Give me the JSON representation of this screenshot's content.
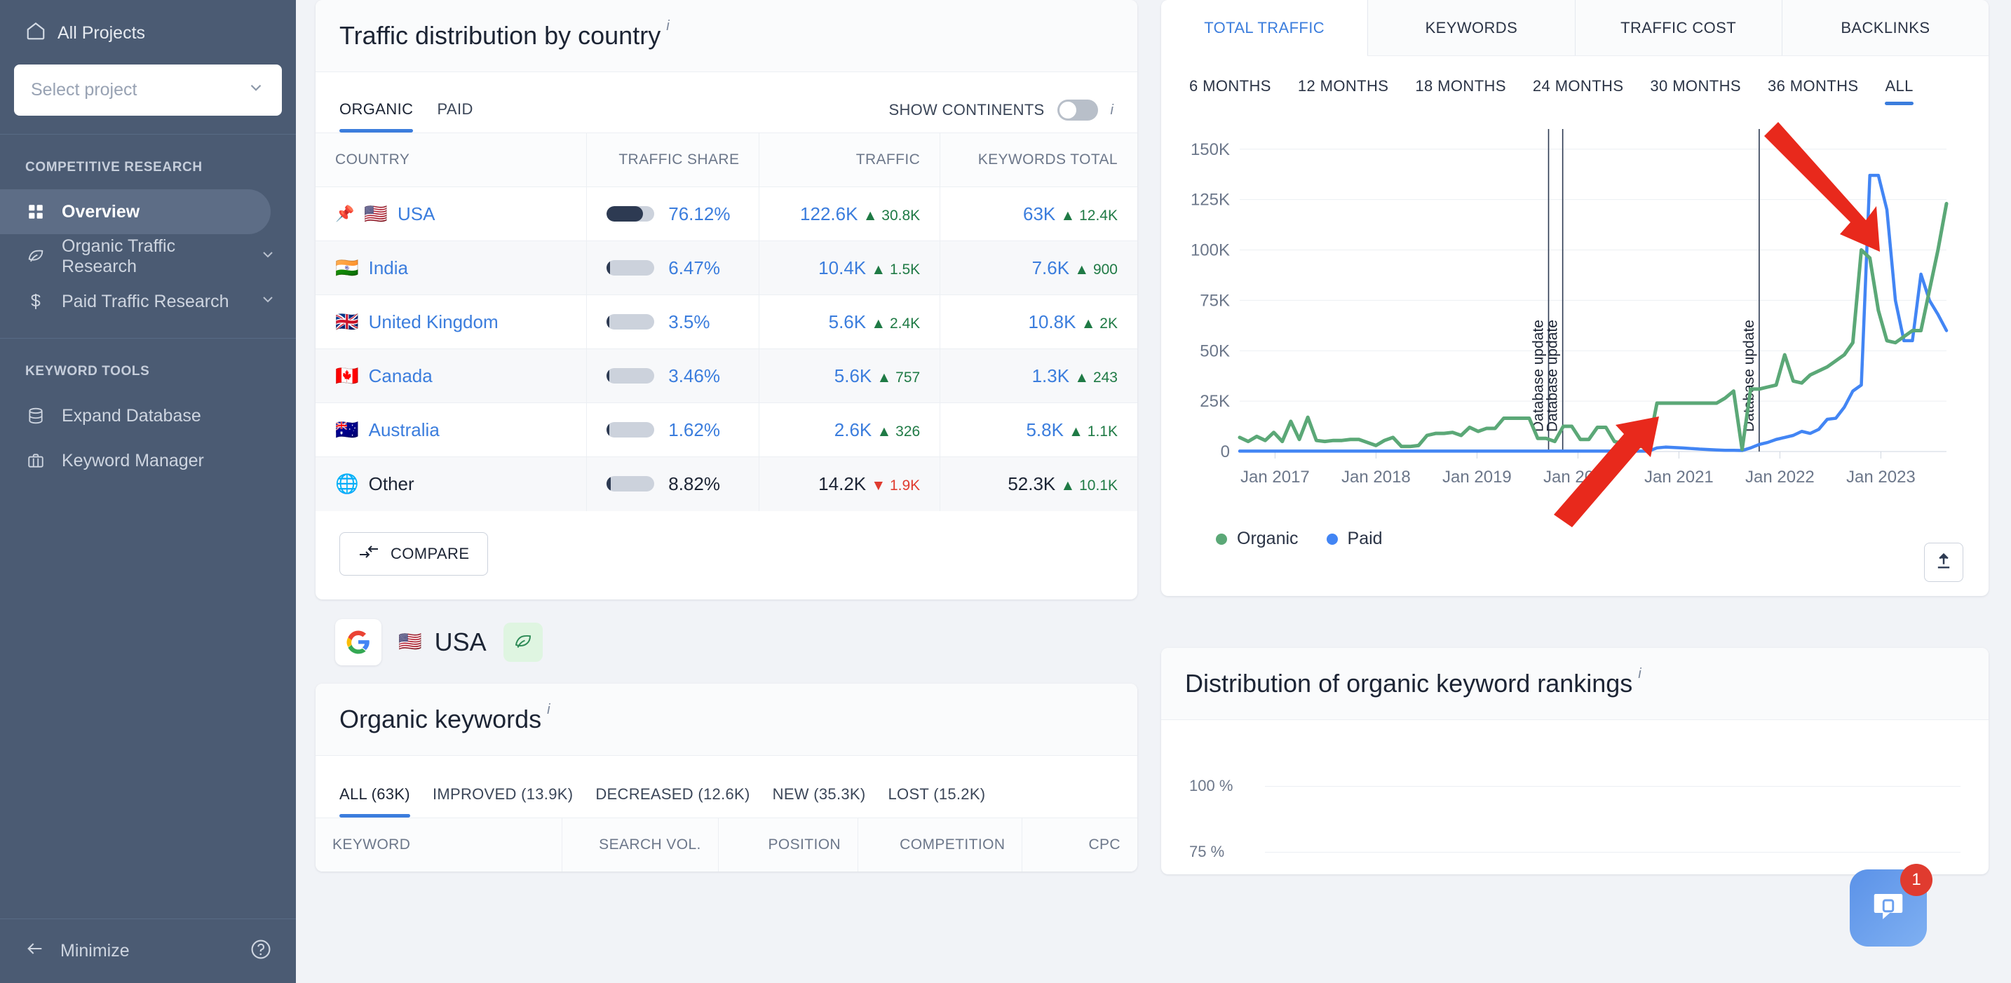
{
  "sidebar": {
    "all_projects": "All Projects",
    "project_select_placeholder": "Select project",
    "sections": [
      {
        "label": "COMPETITIVE RESEARCH",
        "items": [
          {
            "label": "Overview",
            "icon": "grid-icon",
            "active": true,
            "chevron": false
          },
          {
            "label": "Organic Traffic Research",
            "icon": "leaf-icon",
            "active": false,
            "chevron": true
          },
          {
            "label": "Paid Traffic Research",
            "icon": "dollar-icon",
            "active": false,
            "chevron": true
          }
        ]
      },
      {
        "label": "KEYWORD TOOLS",
        "items": [
          {
            "label": "Expand Database",
            "icon": "database-icon",
            "active": false,
            "chevron": false
          },
          {
            "label": "Keyword Manager",
            "icon": "briefcase-icon",
            "active": false,
            "chevron": false
          }
        ]
      }
    ],
    "minimize": "Minimize",
    "help_icon": "help-circle-icon"
  },
  "traffic_card": {
    "title": "Traffic distribution by country",
    "info_icon": "i",
    "tabs": [
      {
        "label": "ORGANIC",
        "active": true
      },
      {
        "label": "PAID",
        "active": false
      }
    ],
    "toggle_label": "SHOW CONTINENTS",
    "toggle_on": false,
    "columns": [
      "COUNTRY",
      "TRAFFIC SHARE",
      "TRAFFIC",
      "KEYWORDS TOTAL"
    ],
    "rows": [
      {
        "flag": "🇺🇸",
        "pinned": true,
        "country": "USA",
        "share_pct": 76.12,
        "share": "76.12%",
        "traffic": "122.6K",
        "traffic_delta": "30.8K",
        "traffic_dir": "up",
        "keywords": "63K",
        "keywords_delta": "12.4K",
        "keywords_dir": "up",
        "other": false
      },
      {
        "flag": "🇮🇳",
        "pinned": false,
        "country": "India",
        "share_pct": 6.47,
        "share": "6.47%",
        "traffic": "10.4K",
        "traffic_delta": "1.5K",
        "traffic_dir": "up",
        "keywords": "7.6K",
        "keywords_delta": "900",
        "keywords_dir": "up",
        "other": false
      },
      {
        "flag": "🇬🇧",
        "pinned": false,
        "country": "United Kingdom",
        "share_pct": 3.5,
        "share": "3.5%",
        "traffic": "5.6K",
        "traffic_delta": "2.4K",
        "traffic_dir": "up",
        "keywords": "10.8K",
        "keywords_delta": "2K",
        "keywords_dir": "up",
        "other": false
      },
      {
        "flag": "🇨🇦",
        "pinned": false,
        "country": "Canada",
        "share_pct": 3.46,
        "share": "3.46%",
        "traffic": "5.6K",
        "traffic_delta": "757",
        "traffic_dir": "up",
        "keywords": "1.3K",
        "keywords_delta": "243",
        "keywords_dir": "up",
        "other": false
      },
      {
        "flag": "🇦🇺",
        "pinned": false,
        "country": "Australia",
        "share_pct": 1.62,
        "share": "1.62%",
        "traffic": "2.6K",
        "traffic_delta": "326",
        "traffic_dir": "up",
        "keywords": "5.8K",
        "keywords_delta": "1.1K",
        "keywords_dir": "up",
        "other": false
      },
      {
        "flag": "🌐",
        "pinned": false,
        "country": "Other",
        "share_pct": 8.82,
        "share": "8.82%",
        "traffic": "14.2K",
        "traffic_delta": "1.9K",
        "traffic_dir": "down",
        "keywords": "52.3K",
        "keywords_delta": "10.1K",
        "keywords_dir": "up",
        "other": true
      }
    ],
    "compare_button": "COMPARE",
    "compare_icon": "compare-arrows-icon"
  },
  "chart_card": {
    "tabs": [
      {
        "label": "TOTAL TRAFFIC",
        "active": true
      },
      {
        "label": "KEYWORDS",
        "active": false
      },
      {
        "label": "TRAFFIC COST",
        "active": false
      },
      {
        "label": "BACKLINKS",
        "active": false
      }
    ],
    "ranges": [
      {
        "label": "6 MONTHS",
        "active": false
      },
      {
        "label": "12 MONTHS",
        "active": false
      },
      {
        "label": "18 MONTHS",
        "active": false
      },
      {
        "label": "24 MONTHS",
        "active": false
      },
      {
        "label": "30 MONTHS",
        "active": false
      },
      {
        "label": "36 MONTHS",
        "active": false
      },
      {
        "label": "ALL",
        "active": true
      }
    ],
    "export_icon": "export-upload-icon"
  },
  "chart_data": {
    "type": "line",
    "title": "Total traffic",
    "xlabel": "",
    "ylabel": "",
    "ylim": [
      0,
      160000
    ],
    "yticks": [
      0,
      25000,
      50000,
      75000,
      100000,
      125000,
      150000
    ],
    "ytick_labels": [
      "0",
      "25K",
      "50K",
      "75K",
      "100K",
      "125K",
      "150K"
    ],
    "xtick_labels": [
      "Jan 2017",
      "Jan 2018",
      "Jan 2019",
      "Jan 2020",
      "Jan 2021",
      "Jan 2022",
      "Jan 2023"
    ],
    "grid": true,
    "legend_position": "bottom-left",
    "annotations": [
      {
        "type": "vline",
        "label": "Database update",
        "x_frac": 0.437
      },
      {
        "type": "vline",
        "label": "Database update",
        "x_frac": 0.457
      },
      {
        "type": "vline",
        "label": "Database update",
        "x_frac": 0.735
      },
      {
        "type": "arrow",
        "label": "red-arrow-down-right",
        "color": "#e8291c"
      },
      {
        "type": "arrow",
        "label": "red-arrow-up-right",
        "color": "#e8291c"
      }
    ],
    "series": [
      {
        "name": "Organic",
        "color": "#5ba877",
        "values": [
          7000,
          5000,
          7500,
          5500,
          9500,
          5000,
          15000,
          6000,
          17000,
          5500,
          5000,
          5500,
          5500,
          6000,
          6000,
          4500,
          3000,
          5500,
          7000,
          2500,
          2500,
          3000,
          8000,
          9000,
          9000,
          9500,
          8000,
          12000,
          10000,
          11500,
          11500,
          16500,
          16500,
          16500,
          16500,
          6500,
          6500,
          5000,
          12500,
          12500,
          6000,
          6000,
          12000,
          12000,
          5000,
          4000,
          3500,
          2500,
          2500,
          24000,
          24000,
          24000,
          24000,
          24000,
          24000,
          24000,
          24000,
          26500,
          30000,
          1000,
          31000,
          31000,
          32000,
          33000,
          48000,
          35000,
          34000,
          38000,
          40000,
          42000,
          45000,
          48000,
          54000,
          100000,
          96000,
          70000,
          55000,
          54000,
          57000,
          60000,
          60000,
          80000,
          100000,
          123000
        ]
      },
      {
        "name": "Paid",
        "color": "#4285f4",
        "values": [
          200,
          200,
          200,
          200,
          200,
          200,
          200,
          200,
          200,
          200,
          200,
          200,
          200,
          200,
          200,
          200,
          200,
          200,
          200,
          200,
          200,
          200,
          200,
          200,
          200,
          200,
          200,
          200,
          200,
          200,
          200,
          200,
          200,
          200,
          200,
          200,
          200,
          200,
          200,
          200,
          200,
          200,
          200,
          200,
          200,
          200,
          200,
          200,
          200,
          1800,
          2200,
          2000,
          1800,
          1500,
          1200,
          1000,
          800,
          600,
          600,
          500,
          1800,
          3500,
          4500,
          6000,
          7000,
          8000,
          10000,
          9000,
          11000,
          16000,
          16500,
          22000,
          30000,
          33000,
          137000,
          137000,
          120000,
          75000,
          55000,
          55000,
          88000,
          75000,
          68000,
          60000
        ]
      }
    ]
  },
  "location_strip": {
    "search_engine_icon": "google-icon",
    "flag": "🇺🇸",
    "country": "USA",
    "organic_icon": "leaf-icon"
  },
  "organic_keywords_card": {
    "title": "Organic keywords",
    "info_icon": "i",
    "tabs": [
      {
        "label": "ALL (63K)",
        "active": true
      },
      {
        "label": "IMPROVED (13.9K)",
        "active": false
      },
      {
        "label": "DECREASED (12.6K)",
        "active": false
      },
      {
        "label": "NEW (35.3K)",
        "active": false
      },
      {
        "label": "LOST (15.2K)",
        "active": false
      }
    ],
    "columns": [
      "KEYWORD",
      "SEARCH VOL.",
      "POSITION",
      "COMPETITION",
      "CPC"
    ]
  },
  "distribution_card": {
    "title": "Distribution of organic keyword rankings",
    "info_icon": "i"
  },
  "distribution_chart": {
    "type": "line",
    "title": "Distribution of organic keyword rankings",
    "ytick_labels": [
      "100 %",
      "75 %"
    ],
    "yticks": [
      100,
      75
    ],
    "grid": true
  },
  "chat_widget": {
    "icon": "chat-bubble-icon",
    "badge_count": "1",
    "color": "#5b92e8",
    "badge_color": "#e03b2f"
  },
  "colors": {
    "sidebar_bg": "#4b5b73",
    "page_bg": "#f1f3f7",
    "accent_blue": "#3b7ddd",
    "organic_green": "#5ba877",
    "paid_blue": "#4285f4",
    "delta_up": "#1f7a45",
    "delta_down": "#e03b2f",
    "arrow_red": "#e8291c"
  }
}
